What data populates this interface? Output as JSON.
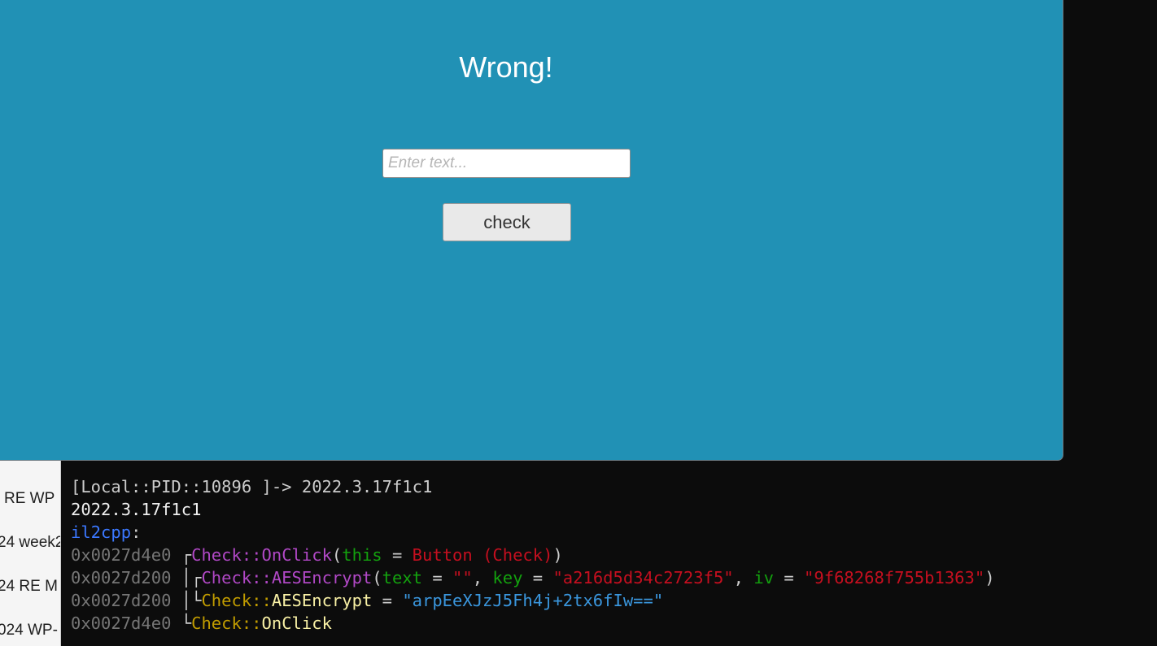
{
  "game": {
    "status_text": "Wrong!",
    "input_placeholder": "Enter text...",
    "input_value": "",
    "check_label": "check"
  },
  "background_list": {
    "items": [
      "RE WP",
      "24 week2",
      "24 RE M",
      "024 WP-"
    ]
  },
  "terminal": {
    "prompt": "[Local::PID::10896 ]->",
    "command": " 2022.3.17f1c1",
    "output_version": "2022.3.17f1c1",
    "il2cpp_label": "il2cpp",
    "il2cpp_colon": ":",
    "trace": [
      {
        "addr": "0x0027d4e0",
        "tree": " ┌",
        "cls": "Check",
        "sep": "::",
        "method": "OnClick",
        "open": "(",
        "arg1_name": "this",
        "eq1": " = ",
        "arg1_value": "Button (Check)",
        "close": ")"
      },
      {
        "addr": "0x0027d200",
        "tree": " │┌",
        "cls": "Check",
        "sep": "::",
        "method": "AESEncrypt",
        "open": "(",
        "arg1_name": "text",
        "eq1": " = ",
        "arg1_value": "\"\"",
        "comma1": ", ",
        "arg2_name": "key",
        "eq2": " = ",
        "arg2_value": "\"a216d5d34c2723f5\"",
        "comma2": ", ",
        "arg3_name": "iv",
        "eq3": " = ",
        "arg3_value": "\"9f68268f755b1363\"",
        "close": ")"
      },
      {
        "addr": "0x0027d200",
        "tree": " │└",
        "cls": "Check",
        "sep": "::",
        "method": "AESEncrypt",
        "eq": " = ",
        "ret_value": "\"arpEeXJzJ5Fh4j+2tx6fIw==\""
      },
      {
        "addr": "0x0027d4e0",
        "tree": " └",
        "cls": "Check",
        "sep": "::",
        "method": "OnClick"
      }
    ]
  },
  "colors": {
    "game_bg": "#2191b5",
    "terminal_bg": "#0c0c0c"
  }
}
